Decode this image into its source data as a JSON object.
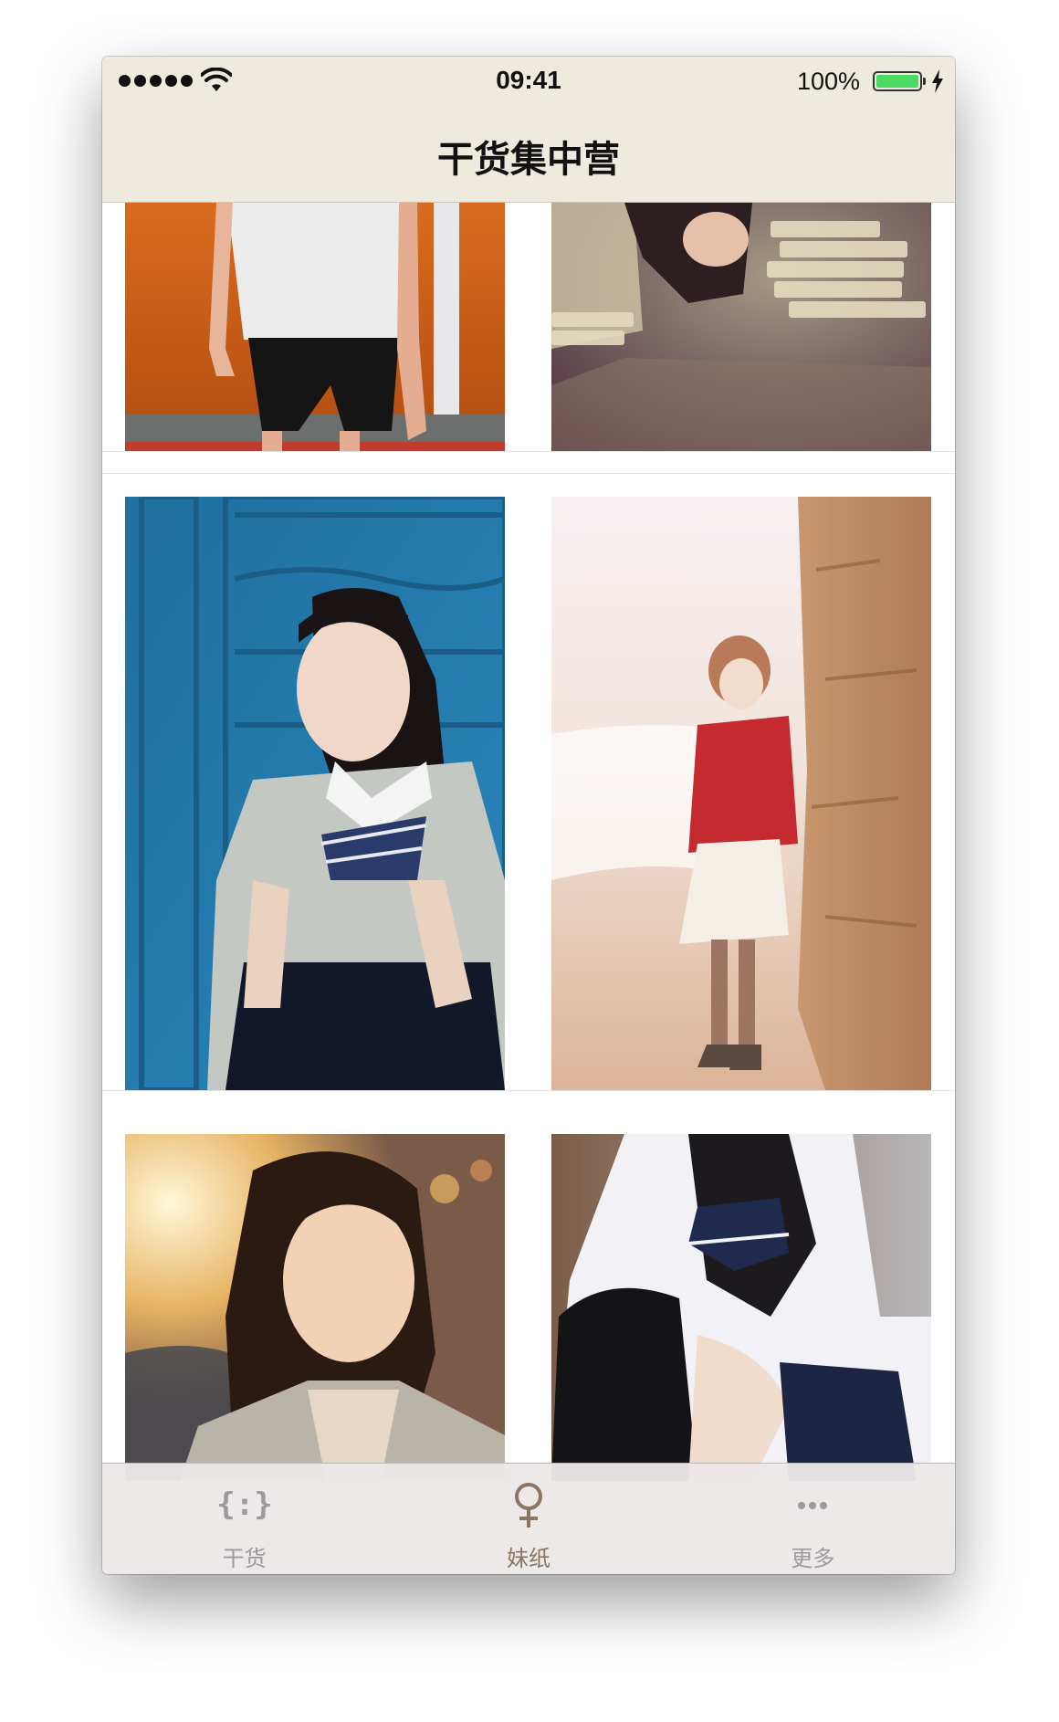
{
  "status_bar": {
    "time": "09:41",
    "battery_percent_text": "100%",
    "battery_level": 1.0,
    "signal_bars": 5,
    "battery_color": "#4cd964"
  },
  "nav_bar": {
    "title": "干货集中营",
    "background_color": "#eeeadd"
  },
  "gallery": {
    "photos": [
      {
        "description_icon": "photo-thumbnail",
        "row": 1,
        "col": 1
      },
      {
        "description_icon": "photo-thumbnail",
        "row": 1,
        "col": 2
      },
      {
        "description_icon": "photo-thumbnail",
        "row": 2,
        "col": 1
      },
      {
        "description_icon": "photo-thumbnail",
        "row": 2,
        "col": 2
      },
      {
        "description_icon": "photo-thumbnail",
        "row": 3,
        "col": 1
      },
      {
        "description_icon": "photo-thumbnail",
        "row": 3,
        "col": 2
      }
    ]
  },
  "tab_bar": {
    "tabs": [
      {
        "label": "干货",
        "icon": "braces-icon",
        "selected": false
      },
      {
        "label": "妹纸",
        "icon": "female-symbol-icon",
        "selected": true
      },
      {
        "label": "更多",
        "icon": "more-dots-icon",
        "selected": false
      }
    ],
    "selected_color": "#8a7560",
    "unselected_color": "#9a9a9a"
  }
}
